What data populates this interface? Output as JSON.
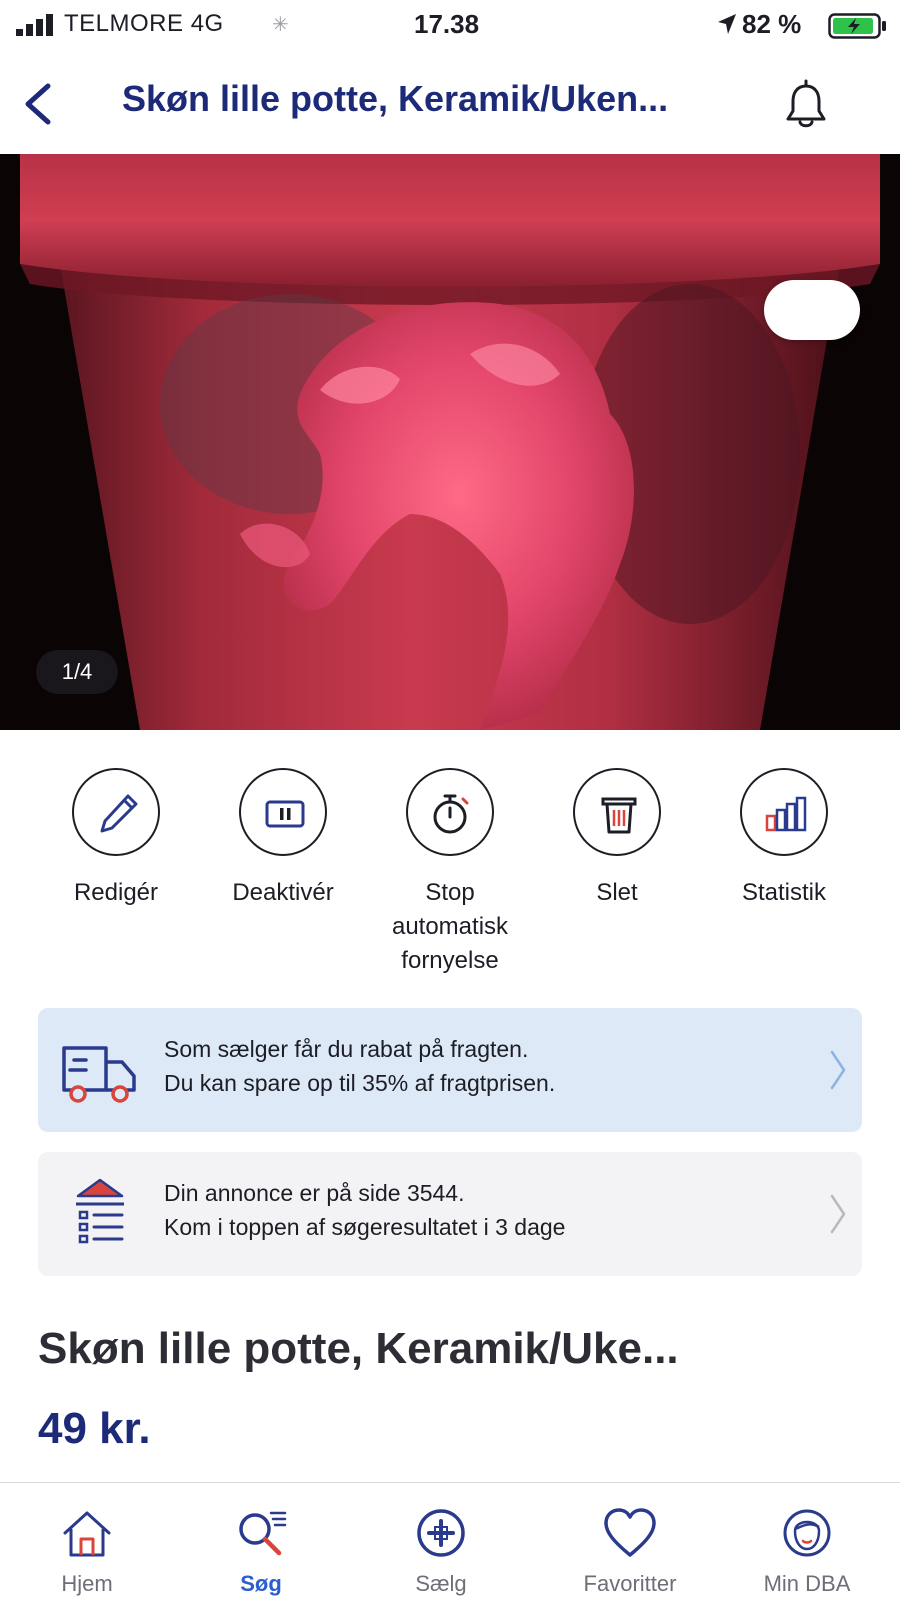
{
  "status_bar": {
    "carrier": "TELMORE",
    "network": "4G",
    "time": "17.38",
    "battery_percent": "82 %"
  },
  "nav": {
    "title": "Skøn lille potte, Keramik/Uken..."
  },
  "photo": {
    "counter": "1/4",
    "current_index": 1,
    "total": 4
  },
  "actions": [
    {
      "label": "Redigér",
      "icon": "pencil-icon"
    },
    {
      "label": "Deaktivér",
      "icon": "pause-icon"
    },
    {
      "label": "Stop automatisk fornyelse",
      "line1": "Stop",
      "line2": "automatisk",
      "line3": "fornyelse",
      "icon": "stopwatch-icon"
    },
    {
      "label": "Slet",
      "icon": "trash-icon"
    },
    {
      "label": "Statistik",
      "icon": "bar-chart-icon"
    }
  ],
  "shipping_card": {
    "line1": "Som sælger får du rabat på fragten.",
    "line2": "Du kan spare op til 35% af fragtprisen.",
    "icon": "delivery-truck-icon"
  },
  "top_card": {
    "line1": "Din annonce er på side 3544.",
    "line2": "Kom i toppen af søgeresultatet i 3 dage",
    "icon": "rank-list-icon"
  },
  "listing": {
    "title": "Skøn lille potte, Keramik/Uke...",
    "price": "49 kr."
  },
  "tabs": [
    {
      "label": "Hjem",
      "icon": "home-icon",
      "active": false
    },
    {
      "label": "Søg",
      "icon": "search-icon",
      "active": true
    },
    {
      "label": "Sælg",
      "icon": "plus-circle-icon",
      "active": false
    },
    {
      "label": "Favoritter",
      "icon": "heart-icon",
      "active": false
    },
    {
      "label": "Min DBA",
      "icon": "profile-icon",
      "active": false
    }
  ],
  "colors": {
    "brand_navy": "#1c2a78",
    "active_tab": "#2b5fd1",
    "favorite_red": "#d9453c",
    "shipping_card_bg": "#dde9f7",
    "top_card_bg": "#f3f3f5"
  }
}
